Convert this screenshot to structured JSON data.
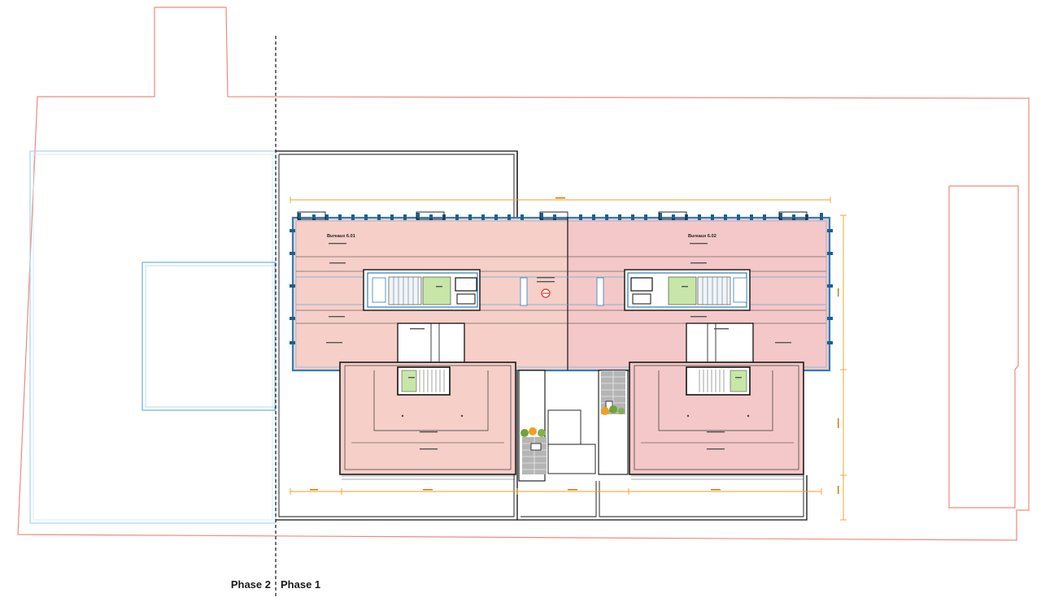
{
  "phases": {
    "left_label": "Phase 2",
    "right_label": "Phase 1"
  },
  "rooms": {
    "office_a": "Bureaux 6.01",
    "office_b": "Bureaux 6.02"
  },
  "colors": {
    "site_boundary": "#f08a7a",
    "phase2_outline": "#a8d4ec",
    "office_fill": "#f6cfc8",
    "office_fill_b": "#f4c8c8",
    "core_fill": "#ffffff",
    "wall_blue": "#2e7fb8",
    "dimension": "#f0a020",
    "wet_room": "#c7e6a8",
    "outline": "#1a1a1a"
  }
}
